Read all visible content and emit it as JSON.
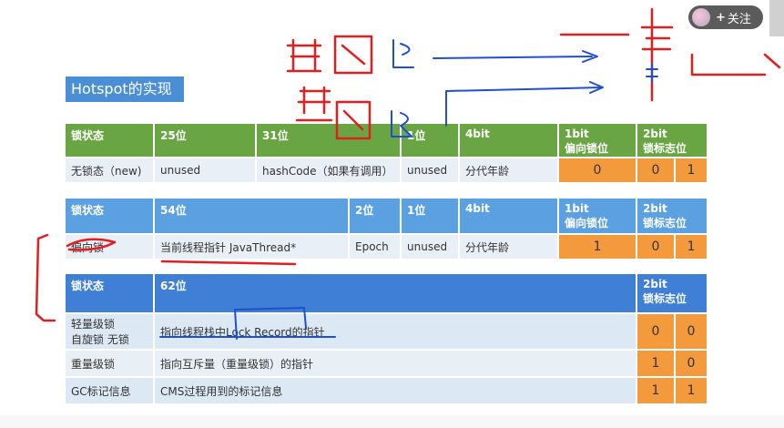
{
  "page": {
    "title": "Hotspot的实现",
    "follow_label": "关注",
    "follow_plus": "+",
    "icons": {
      "avatar": "avatar-icon",
      "plus": "plus-icon"
    }
  },
  "table1": {
    "headers": [
      "锁状态",
      "25位",
      "31位",
      "1位",
      "4bit",
      "1bit 偏向锁位",
      "2bit 锁标志位"
    ],
    "header_split": [
      [
        "1bit",
        "偏向锁位"
      ],
      [
        "2bit",
        "锁标志位"
      ]
    ],
    "row": [
      "无锁态（new)",
      "unused",
      "hashCode（如果有调用）",
      "unused",
      "分代年龄",
      "0",
      "0",
      "1"
    ]
  },
  "table2": {
    "headers": [
      "锁状态",
      "54位",
      "2位",
      "1位",
      "4bit"
    ],
    "header_split": [
      [
        "1bit",
        "偏向锁位"
      ],
      [
        "2bit",
        "锁标志位"
      ]
    ],
    "row": [
      "偏向锁",
      "当前线程指针 JavaThread*",
      "Epoch",
      "unused",
      "分代年龄",
      "1",
      "0",
      "1"
    ]
  },
  "table3": {
    "headers": [
      "锁状态",
      "62位"
    ],
    "header_split": [
      "2bit",
      "锁标志位"
    ],
    "rows": [
      {
        "state": [
          "轻量级锁",
          "自旋锁 无锁"
        ],
        "desc": "指向线程栈中Lock Record的指针",
        "b1": "0",
        "b2": "0"
      },
      {
        "state": [
          "重量级锁"
        ],
        "desc": "指向互斥量（重量级锁）的指针",
        "b1": "1",
        "b2": "0"
      },
      {
        "state": [
          "GC标记信息"
        ],
        "desc": "CMS过程用到的标记信息",
        "b1": "1",
        "b2": "1"
      }
    ]
  },
  "colors": {
    "green_header": "#6aa544",
    "blue_header_light": "#5ba0e0",
    "blue_header_dark": "#3f7fd6",
    "orange": "#f39a3c",
    "annotation_red": "#e02020",
    "annotation_blue": "#1f4fd1"
  }
}
